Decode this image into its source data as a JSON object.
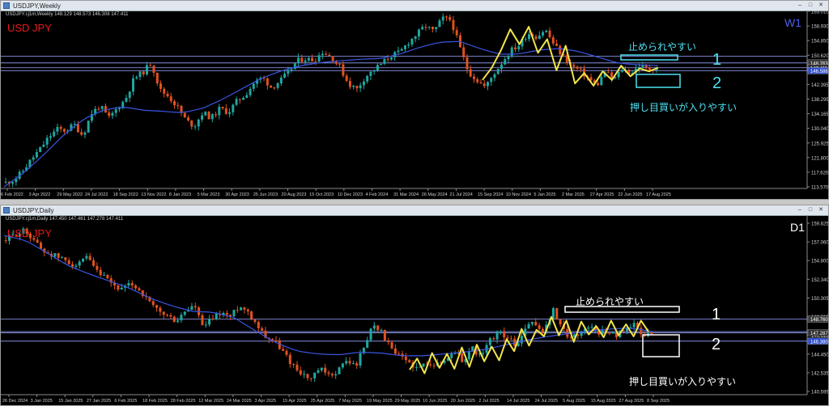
{
  "windows": [
    {
      "id": "top",
      "window_title": "USDJPY,Weekly",
      "ohlc_text": "USDJPY.cj1m,Weekly  148.129 148.573 146.308 147.411",
      "symbol_label": "USD JPY",
      "timeframe_label": "W1",
      "annotation_resistance": "止められやすい",
      "annotation_support": "押し目買いが入りやすい",
      "level_1_label": "1",
      "level_2_label": "2",
      "colors": {
        "bull": "#1fa7a0",
        "bear": "#e0521f",
        "ma": "#3a55e0",
        "zigzag": "#f2e54a",
        "hline": "#9aa4ff",
        "annot": "#4fe0f0",
        "symbol": "#e8191a",
        "tf": "#4f5fe8"
      },
      "chart_data": {
        "type": "candlestick",
        "x_tick_labels": [
          "6 Feb 2022",
          "3 Apr 2022",
          "29 May 2022",
          "24 Jul 2022",
          "18 Sep 2022",
          "13 Nov 2022",
          "8 Jan 2023",
          "5 Mar 2023",
          "30 Apr 2023",
          "25 Jun 2023",
          "20 Aug 2023",
          "15 Oct 2023",
          "10 Dec 2023",
          "4 Feb 2024",
          "31 Mar 2024",
          "26 May 2024",
          "21 Jul 2024",
          "15 Sep 2024",
          "10 Nov 2024",
          "5 Jan 2025",
          "2 Mar 2025",
          "27 Apr 2025",
          "22 Jun 2025",
          "17 Aug 2025"
        ],
        "y_tick_labels": [
          "163.010",
          "158.930",
          "154.850",
          "150.620",
          "146.515",
          "142.395",
          "138.295",
          "134.165",
          "130.040",
          "125.925",
          "121.800",
          "117.620",
          "113.570"
        ],
        "ylim": [
          113.57,
          163.01
        ],
        "price_tags": [
          "148.763",
          "147.411",
          "146.586"
        ],
        "horizontal_levels": [
          150.62,
          148.76,
          147.41,
          146.59
        ],
        "close_points": [
          115.2,
          116.0,
          118.5,
          121.8,
          124.6,
          127.9,
          130.2,
          129.8,
          131.5,
          128.4,
          134.6,
          136.8,
          133.2,
          136.0,
          138.7,
          144.5,
          146.1,
          148.9,
          141.2,
          139.4,
          136.6,
          132.8,
          131.0,
          134.9,
          133.3,
          136.0,
          134.9,
          138.1,
          139.9,
          143.2,
          144.7,
          141.9,
          143.6,
          146.1,
          149.3,
          150.0,
          149.5,
          151.9,
          150.4,
          147.7,
          143.0,
          141.4,
          144.9,
          146.8,
          148.8,
          150.9,
          151.6,
          154.5,
          156.8,
          159.2,
          157.5,
          161.3,
          160.8,
          153.3,
          146.4,
          144.0,
          141.9,
          145.7,
          149.1,
          152.3,
          153.8,
          157.2,
          156.1,
          158.2,
          154.0,
          150.9,
          148.0,
          146.7,
          144.6,
          142.3,
          146.4,
          144.0,
          147.2,
          145.8,
          148.0,
          147.0,
          147.4
        ],
        "ma_points": [
          114.0,
          118.0,
          123.0,
          128.5,
          133.0,
          135.5,
          136.5,
          135.5,
          135.2,
          134.8,
          136.0,
          138.5,
          141.5,
          144.5,
          146.6,
          148.0,
          148.9,
          149.4,
          149.8,
          150.0,
          151.3,
          153.2,
          154.6,
          154.8,
          152.8,
          151.2,
          151.3,
          152.4,
          152.8,
          152.0,
          150.3,
          148.7,
          148.2,
          148.0
        ],
        "zigzag": [
          144.0,
          147.4,
          152.3,
          158.2,
          154.0,
          158.9,
          151.6,
          155.4,
          146.7,
          153.6,
          143.0,
          145.9,
          142.4,
          146.4,
          144.0,
          148.0,
          145.0,
          147.2,
          146.4,
          147.4
        ]
      }
    },
    {
      "id": "bot",
      "window_title": "USDJPY,Daily",
      "ohlc_text": "USDJPY.cj1m,Daily  147.450 147.461 147.278 147.411",
      "symbol_label": "USD JPY",
      "timeframe_label": "D1",
      "annotation_resistance": "止められやすい",
      "annotation_support": "押し目買いが入りやすい",
      "level_1_label": "1",
      "level_2_label": "2",
      "colors": {
        "bull": "#1fa7a0",
        "bear": "#e0521f",
        "ma": "#3a55e0",
        "zigzag": "#f2e54a",
        "hline": "#9aa4ff",
        "annot": "#ffffff",
        "symbol": "#e8191a",
        "tf": "#ffffff"
      },
      "chart_data": {
        "type": "candlestick",
        "x_tick_labels": [
          "26 Dec 2024",
          "3 Jan 2025",
          "15 Jan 2025",
          "27 Jan 2025",
          "6 Feb 2025",
          "18 Feb 2025",
          "28 Feb 2025",
          "12 Mar 2025",
          "24 Mar 2025",
          "3 Apr 2025",
          "15 Apr 2025",
          "25 Apr 2025",
          "7 May 2025",
          "19 May 2025",
          "29 May 2025",
          "10 Jun 2025",
          "20 Jun 2025",
          "2 Jul 2025",
          "14 Jul 2025",
          "24 Jul 2025",
          "5 Aug 2025",
          "15 Aug 2025",
          "27 Aug 2025",
          "8 Sep 2025"
        ],
        "y_tick_labels": [
          "159.825",
          "157.060",
          "154.800",
          "152.340",
          "150.305",
          "148.015",
          "146.115",
          "144.450",
          "142.535",
          "140.595"
        ],
        "ylim": [
          140.595,
          159.825
        ],
        "price_tags": [
          "148.760",
          "147.287",
          "146.380"
        ],
        "horizontal_levels": [
          148.76,
          147.411,
          147.287,
          146.38
        ],
        "close_points": [
          157.3,
          157.9,
          158.3,
          157.6,
          156.2,
          155.8,
          155.4,
          154.9,
          154.5,
          155.4,
          154.0,
          153.2,
          152.4,
          151.9,
          152.6,
          151.8,
          150.5,
          149.6,
          149.1,
          148.5,
          149.6,
          150.3,
          147.8,
          148.8,
          149.5,
          149.0,
          150.2,
          149.6,
          148.2,
          146.9,
          146.4,
          145.1,
          143.8,
          142.9,
          142.2,
          143.4,
          142.6,
          143.2,
          144.3,
          143.7,
          145.9,
          148.4,
          147.2,
          145.4,
          144.6,
          144.1,
          143.3,
          144.2,
          143.8,
          144.3,
          145.4,
          144.2,
          145.7,
          144.6,
          146.5,
          147.4,
          146.7,
          145.8,
          147.9,
          148.3,
          147.3,
          149.8,
          147.6,
          146.8,
          147.2,
          148.1,
          147.3,
          147.6,
          146.9,
          147.8,
          148.2,
          146.9,
          147.4
        ],
        "ma_points": [
          157.8,
          157.3,
          156.0,
          154.6,
          153.7,
          152.9,
          152.1,
          151.0,
          150.2,
          149.6,
          149.5,
          148.9,
          147.5,
          146.2,
          145.3,
          145.0,
          144.9,
          145.2,
          145.1,
          144.8,
          144.8,
          145.0,
          145.2,
          145.5,
          146.0,
          146.5,
          146.9,
          147.2,
          147.5,
          147.7,
          147.8,
          147.4
        ],
        "zigzag": [
          143.3,
          144.5,
          142.9,
          145.1,
          143.5,
          145.0,
          143.4,
          145.7,
          143.6,
          146.0,
          144.2,
          145.8,
          144.3,
          146.6,
          145.3,
          147.7,
          145.9,
          147.6,
          146.9,
          149.0,
          147.0,
          148.6,
          146.3,
          148.5,
          147.1,
          148.0,
          146.8,
          148.6,
          147.0,
          148.2,
          146.9,
          148.6,
          147.4
        ]
      }
    }
  ]
}
